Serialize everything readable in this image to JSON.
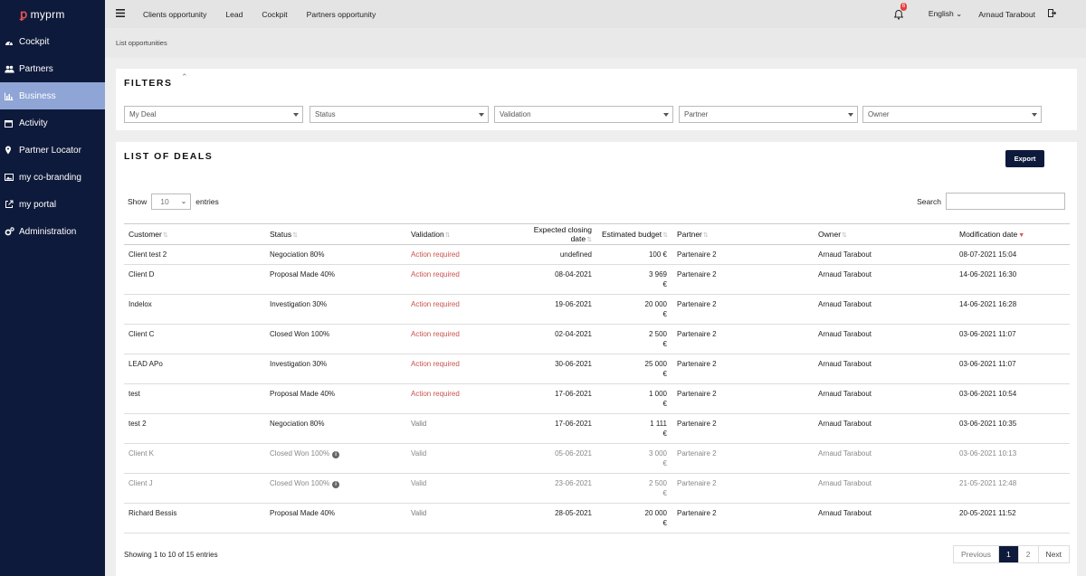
{
  "brand": {
    "logo_text": "myprm"
  },
  "sidebar": {
    "items": [
      {
        "label": "Cockpit",
        "icon": "dashboard-icon"
      },
      {
        "label": "Partners",
        "icon": "users-icon"
      },
      {
        "label": "Business",
        "icon": "bar-chart-icon",
        "active": true
      },
      {
        "label": "Activity",
        "icon": "calendar-icon"
      },
      {
        "label": "Partner Locator",
        "icon": "map-marker-icon"
      },
      {
        "label": "my co-branding",
        "icon": "image-icon"
      },
      {
        "label": "my portal",
        "icon": "external-link-icon"
      },
      {
        "label": "Administration",
        "icon": "cogs-icon"
      }
    ]
  },
  "topbar": {
    "links": [
      "Clients opportunity",
      "Lead",
      "Cockpit",
      "Partners opportunity"
    ],
    "notification_count": "6",
    "language": "English",
    "user": "Arnaud Tarabout"
  },
  "breadcrumb": "List opportunities",
  "filters": {
    "title": "FILTERS",
    "selects": [
      "My Deal",
      "Status",
      "Validation",
      "Partner",
      "Owner"
    ]
  },
  "deals": {
    "title": "LIST OF DEALS",
    "export_label": "Export",
    "show_label": "Show",
    "entries_value": "10",
    "entries_label": "entries",
    "search_label": "Search",
    "columns": [
      "Customer",
      "Status",
      "Validation",
      "Expected closing date",
      "Estimated budget",
      "Partner",
      "Owner",
      "Modification date"
    ],
    "rows": [
      {
        "customer": "Client test 2",
        "status": "Negociation 80%",
        "validation": "Action required",
        "closing": "undefined",
        "budget_line1": "100 €",
        "budget_line2": "",
        "partner": "Partenaire 2",
        "owner": "Arnaud Tarabout",
        "modified": "08-07-2021 15:04"
      },
      {
        "customer": "Client D",
        "status": "Proposal Made 40%",
        "validation": "Action required",
        "closing": "08-04-2021",
        "budget_line1": "3 969",
        "budget_line2": "€",
        "partner": "Partenaire 2",
        "owner": "Arnaud Tarabout",
        "modified": "14-06-2021 16:30"
      },
      {
        "customer": "Indelox",
        "status": "Investigation 30%",
        "validation": "Action required",
        "closing": "19-06-2021",
        "budget_line1": "20 000",
        "budget_line2": "€",
        "partner": "Partenaire 2",
        "owner": "Arnaud Tarabout",
        "modified": "14-06-2021 16:28"
      },
      {
        "customer": "Client C",
        "status": "Closed Won 100%",
        "validation": "Action required",
        "closing": "02-04-2021",
        "budget_line1": "2 500",
        "budget_line2": "€",
        "partner": "Partenaire 2",
        "owner": "Arnaud Tarabout",
        "modified": "03-06-2021 11:07"
      },
      {
        "customer": "LEAD APo",
        "status": "Investigation 30%",
        "validation": "Action required",
        "closing": "30-06-2021",
        "budget_line1": "25 000",
        "budget_line2": "€",
        "partner": "Partenaire 2",
        "owner": "Arnaud Tarabout",
        "modified": "03-06-2021 11:07"
      },
      {
        "customer": "test",
        "status": "Proposal Made 40%",
        "validation": "Action required",
        "closing": "17-06-2021",
        "budget_line1": "1 000",
        "budget_line2": "€",
        "partner": "Partenaire 2",
        "owner": "Arnaud Tarabout",
        "modified": "03-06-2021 10:54"
      },
      {
        "customer": "test 2",
        "status": "Negociation 80%",
        "validation": "Valid",
        "closing": "17-06-2021",
        "budget_line1": "1 111",
        "budget_line2": "€",
        "partner": "Partenaire 2",
        "owner": "Arnaud Tarabout",
        "modified": "03-06-2021 10:35"
      },
      {
        "customer": "Client K",
        "status": "Closed Won 100%",
        "validation": "Valid",
        "closing": "05-06-2021",
        "budget_line1": "3 000",
        "budget_line2": "€",
        "partner": "Partenaire 2",
        "owner": "Arnaud Tarabout",
        "modified": "03-06-2021 10:13",
        "greyed": true,
        "info": true
      },
      {
        "customer": "Client J",
        "status": "Closed Won 100%",
        "validation": "Valid",
        "closing": "23-06-2021",
        "budget_line1": "2 500",
        "budget_line2": "€",
        "partner": "Partenaire 2",
        "owner": "Arnaud Tarabout",
        "modified": "21-05-2021 12:48",
        "greyed": true,
        "info": true
      },
      {
        "customer": "Richard Bessis",
        "status": "Proposal Made 40%",
        "validation": "Valid",
        "closing": "28-05-2021",
        "budget_line1": "20 000",
        "budget_line2": "€",
        "partner": "Partenaire 2",
        "owner": "Arnaud Tarabout",
        "modified": "20-05-2021 11:52"
      }
    ],
    "footer_text": "Showing 1 to 10 of 15 entries",
    "pagination": {
      "previous": "Previous",
      "pages": [
        "1",
        "2"
      ],
      "current": "1",
      "next": "Next"
    }
  },
  "colors": {
    "sidebar_bg": "#0e1a3b",
    "active_item": "#8fa5d6",
    "action_required": "#c9524d",
    "badge": "#e5403c"
  }
}
